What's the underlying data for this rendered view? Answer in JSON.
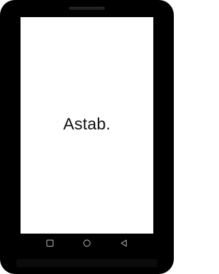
{
  "screen": {
    "content_text": "Astab."
  },
  "navbar": {
    "buttons": [
      {
        "icon": "square-recents-icon"
      },
      {
        "icon": "circle-home-icon"
      },
      {
        "icon": "triangle-back-icon"
      }
    ]
  },
  "colors": {
    "bezel": "#000000",
    "screen_background": "#ffffff",
    "text": "#111111",
    "nav_icon": "#9e9e9e"
  }
}
